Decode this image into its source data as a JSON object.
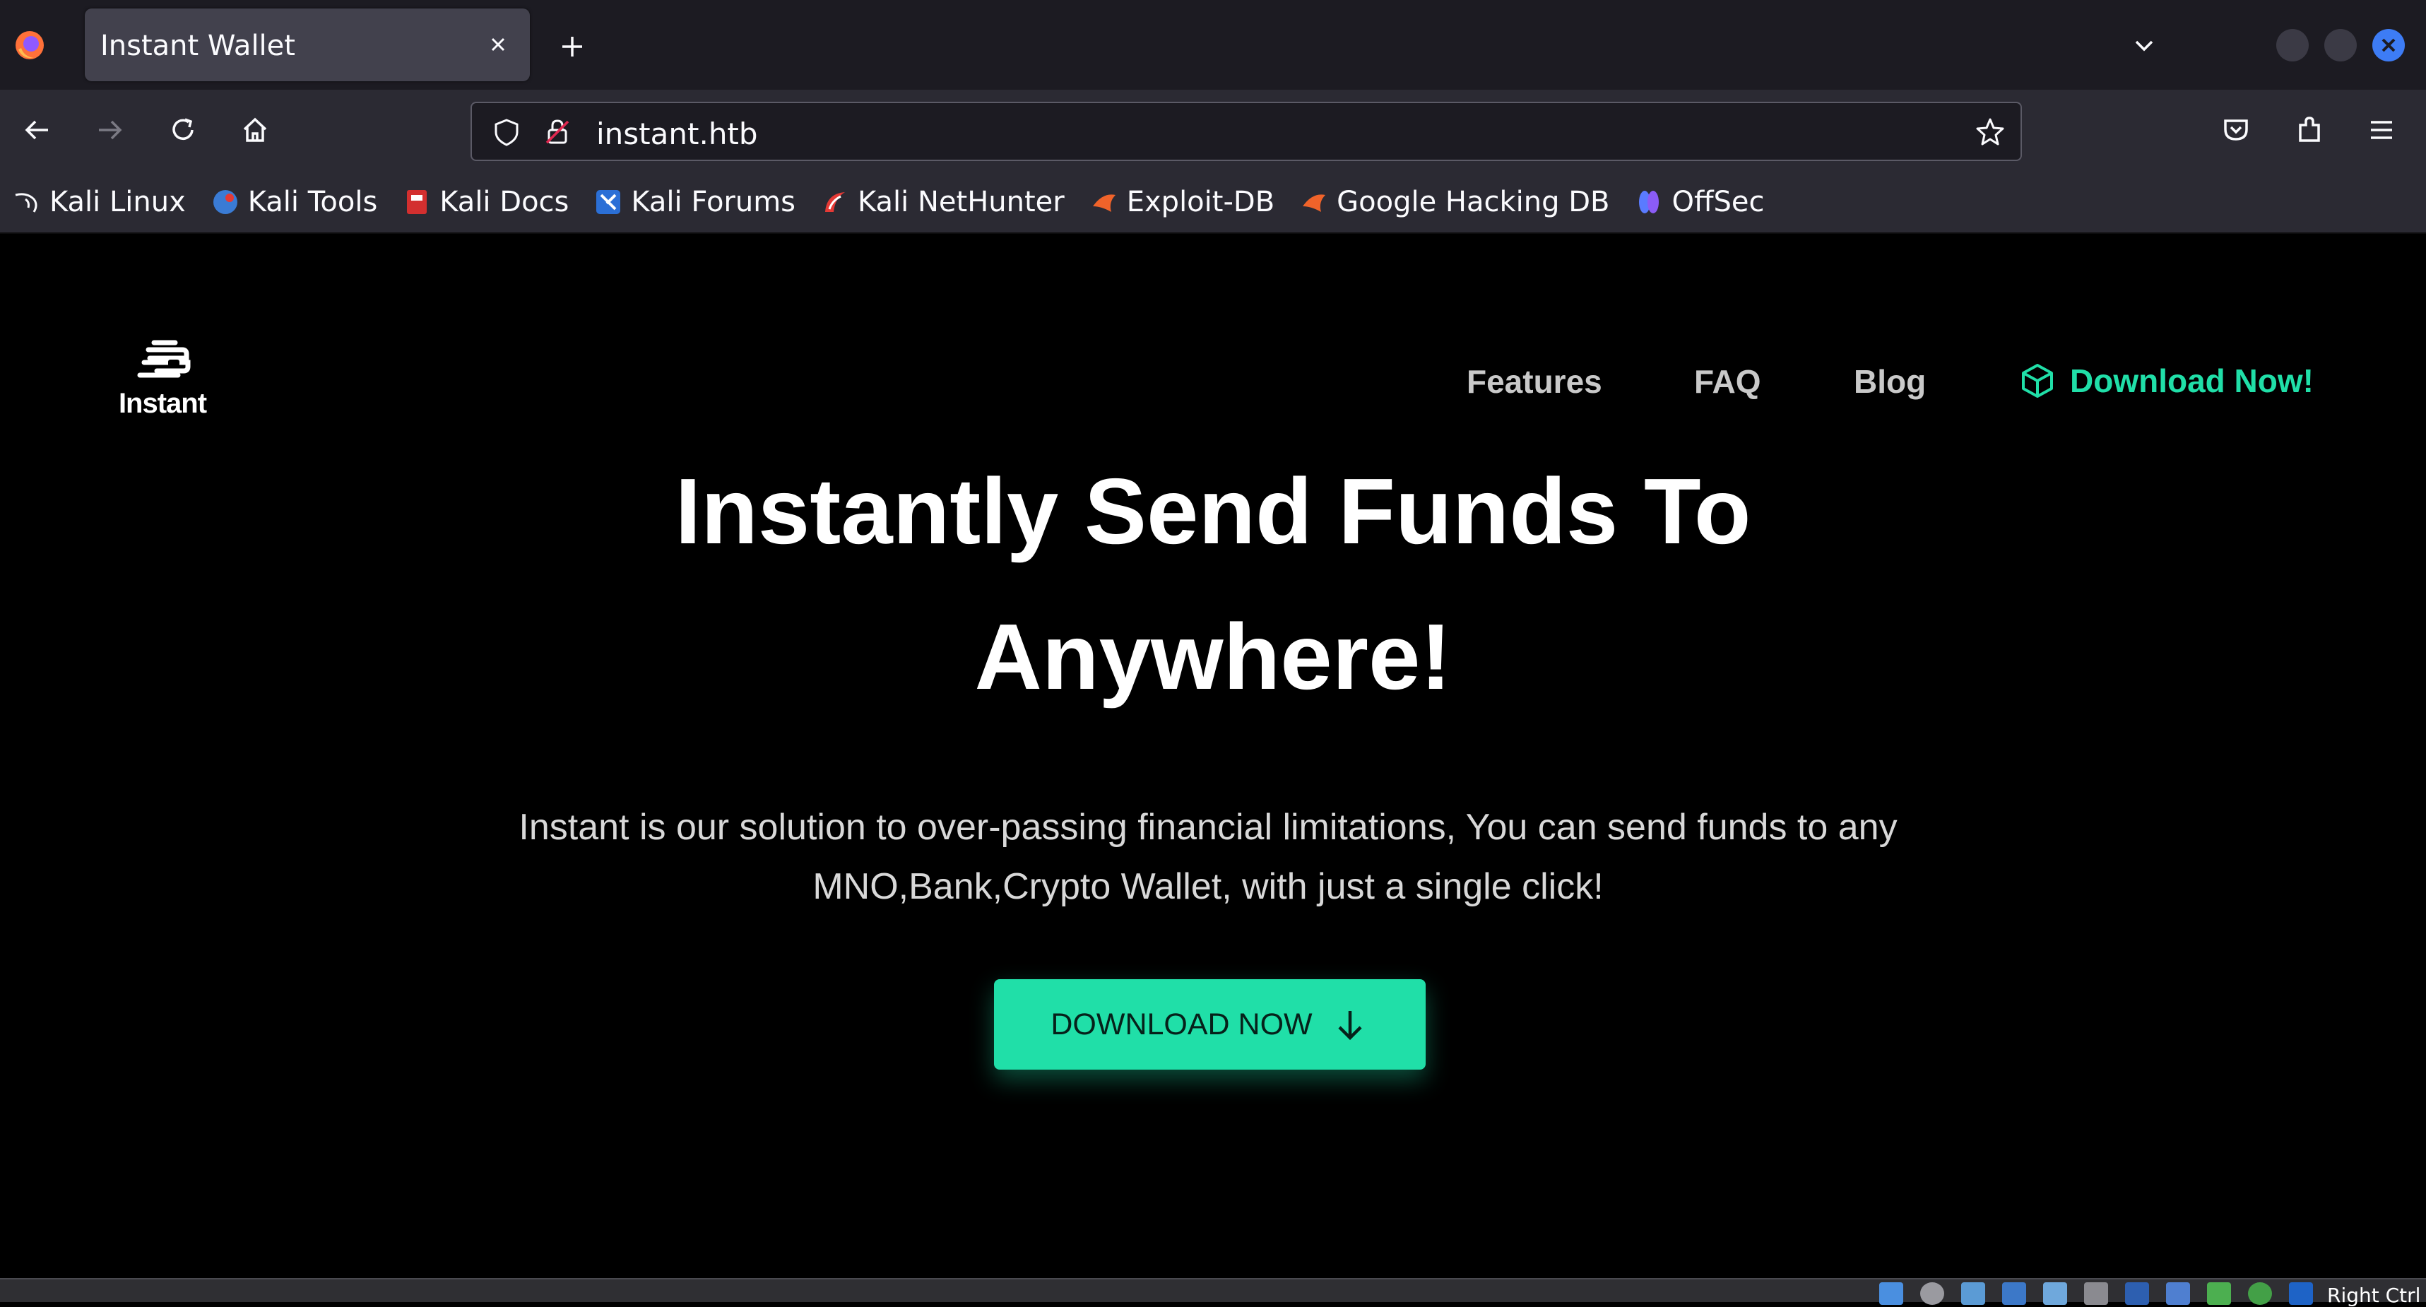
{
  "browser": {
    "tab": {
      "title": "Instant Wallet"
    },
    "url": "instant.htb",
    "bookmarks": [
      {
        "label": "Kali Linux",
        "icon": "kali-dragon-icon"
      },
      {
        "label": "Kali Tools",
        "icon": "kali-tools-icon"
      },
      {
        "label": "Kali Docs",
        "icon": "kali-docs-icon"
      },
      {
        "label": "Kali Forums",
        "icon": "kali-forums-icon"
      },
      {
        "label": "Kali NetHunter",
        "icon": "kali-nethunter-icon"
      },
      {
        "label": "Exploit-DB",
        "icon": "exploit-db-icon"
      },
      {
        "label": "Google Hacking DB",
        "icon": "ghdb-icon"
      },
      {
        "label": "OffSec",
        "icon": "offsec-icon"
      }
    ]
  },
  "site": {
    "logo_text": "Instant",
    "nav": {
      "features": "Features",
      "faq": "FAQ",
      "blog": "Blog",
      "download": "Download Now!"
    },
    "hero": {
      "title_line1": "Instantly Send Funds To",
      "title_line2": "Anywhere!",
      "subtitle_line1": "Instant is our solution to over-passing financial limitations, You can send funds to any",
      "subtitle_line2": "MNO,Bank,Crypto Wallet, with just a single click!",
      "button": "DOWNLOAD NOW"
    }
  },
  "status": {
    "host_key_label": "Right Ctrl"
  },
  "colors": {
    "accent": "#20dfa8",
    "tabbar": "#1c1b22",
    "toolbar": "#2b2a33",
    "page_bg": "#000000",
    "close_button": "#3d7cf5"
  }
}
